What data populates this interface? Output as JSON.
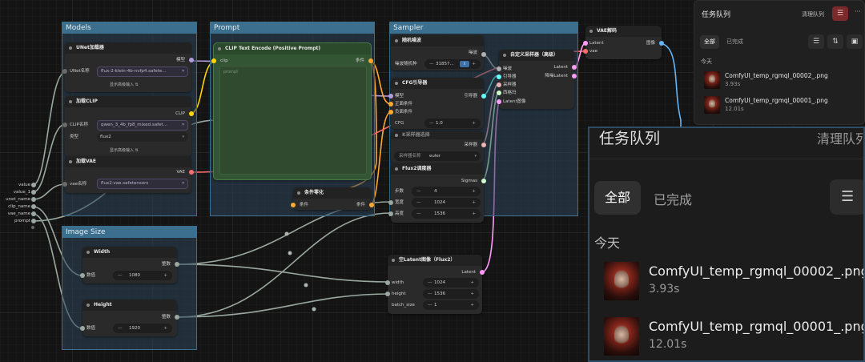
{
  "groups": {
    "models": "Models",
    "prompt": "Prompt",
    "sampler": "Sampler",
    "image_size": "Image Size"
  },
  "unet_loader": {
    "title": "UNet加载器",
    "out_model": "模型",
    "name_label": "UNet名称",
    "name_value": "flux-2-klein-4b-nvfp4.safete...",
    "advanced": "显示高级输入"
  },
  "clip_loader": {
    "title": "加载CLIP",
    "out_clip": "CLIP",
    "name_label": "CLIP名称",
    "name_value": "qwen_3_4b_fp8_mixed.safet...",
    "type_label": "类型",
    "type_value": "flux2",
    "advanced": "显示高级输入"
  },
  "vae_loader": {
    "title": "加载VAE",
    "out_vae": "VAE",
    "name_label": "vae名称",
    "name_value": "flux2-vae.safetensors"
  },
  "subgraph_inputs": [
    "value",
    "value_1",
    "unet_name",
    "clip_name",
    "vae_name",
    "prompt"
  ],
  "clip_encode": {
    "title": "CLIP Text Encode (Positive Prompt)",
    "in_clip": "clip",
    "out_cond": "条件",
    "placeholder": "prompt"
  },
  "cond_zero": {
    "title": "条件零化",
    "in_cond": "条件",
    "out_cond": "条件"
  },
  "random_noise": {
    "title": "随机噪波",
    "out_noise": "噪波",
    "seed_label": "噪波随机种",
    "seed_value": "31857...",
    "seed_badge": "X"
  },
  "cfg_guider": {
    "title": "CFG引导器",
    "in_model": "模型",
    "in_pos": "正面条件",
    "in_neg": "负面条件",
    "out_guider": "引导器",
    "cfg_label": "CFG",
    "cfg_value": "1.0"
  },
  "sampler_select": {
    "title": "K采样器选择",
    "out_sampler": "采样器",
    "name_label": "采样器名称",
    "name_value": "euler"
  },
  "flux2_sched": {
    "title": "Flux2调度器",
    "out_sigmas": "Sigmas",
    "steps_label": "步数",
    "steps_value": "4",
    "width_label": "宽度",
    "width_value": "1024",
    "height_label": "高度",
    "height_value": "1536"
  },
  "custom_sampler": {
    "title": "自定义采样器（高级）",
    "in_noise": "噪波",
    "in_guider": "引导器",
    "in_sampler": "采样器",
    "in_sigmas": "西格玛",
    "in_latent": "Latent图像",
    "out_latent": "Latent",
    "out_denoised": "降噪Latent"
  },
  "vae_decode": {
    "title": "VAE解码",
    "in_latent": "Latent",
    "in_vae": "vae",
    "out_image": "图像"
  },
  "width_node": {
    "title": "Width",
    "out_int": "整数",
    "val_label": "数值",
    "val_value": "1080"
  },
  "height_node": {
    "title": "Height",
    "out_int": "整数",
    "val_label": "数值",
    "val_value": "1920"
  },
  "empty_latent": {
    "title": "空Latent图像（Flux2）",
    "out_latent": "Latent",
    "width_label": "width",
    "width_value": "1024",
    "height_label": "height",
    "height_value": "1536",
    "batch_label": "batch_size",
    "batch_value": "1"
  },
  "queue": {
    "title": "任务队列",
    "clear": "清理队列",
    "tab_all": "全部",
    "tab_done": "已完成",
    "today": "今天",
    "items": [
      {
        "name": "ComfyUI_temp_rgmql_00002_.png",
        "time": "3.93s"
      },
      {
        "name": "ComfyUI_temp_rgmql_00001_.png",
        "time": "12.01s"
      }
    ]
  },
  "queue_zoom": {
    "title": "任务队列",
    "clear": "清理队列",
    "tab_all": "全部",
    "tab_done": "已完成",
    "today": "今天",
    "items": [
      {
        "name": "ComfyUI_temp_rgmql_00002_.png",
        "time": "3.93s"
      },
      {
        "name": "ComfyUI_temp_rgmql_00001_.png",
        "time": "12.01s"
      }
    ]
  },
  "colors": {
    "model": "#b39ddb",
    "clip": "#ffd500",
    "vae": "#ff6e6e",
    "cond": "#ffa931",
    "latent": "#ff9cf9",
    "image": "#64b5f6",
    "int": "#9aa8a0",
    "noise": "#b0b0b0",
    "guider": "#66ffff",
    "sampler": "#ecb4b4",
    "sigmas": "#cdffcd"
  }
}
